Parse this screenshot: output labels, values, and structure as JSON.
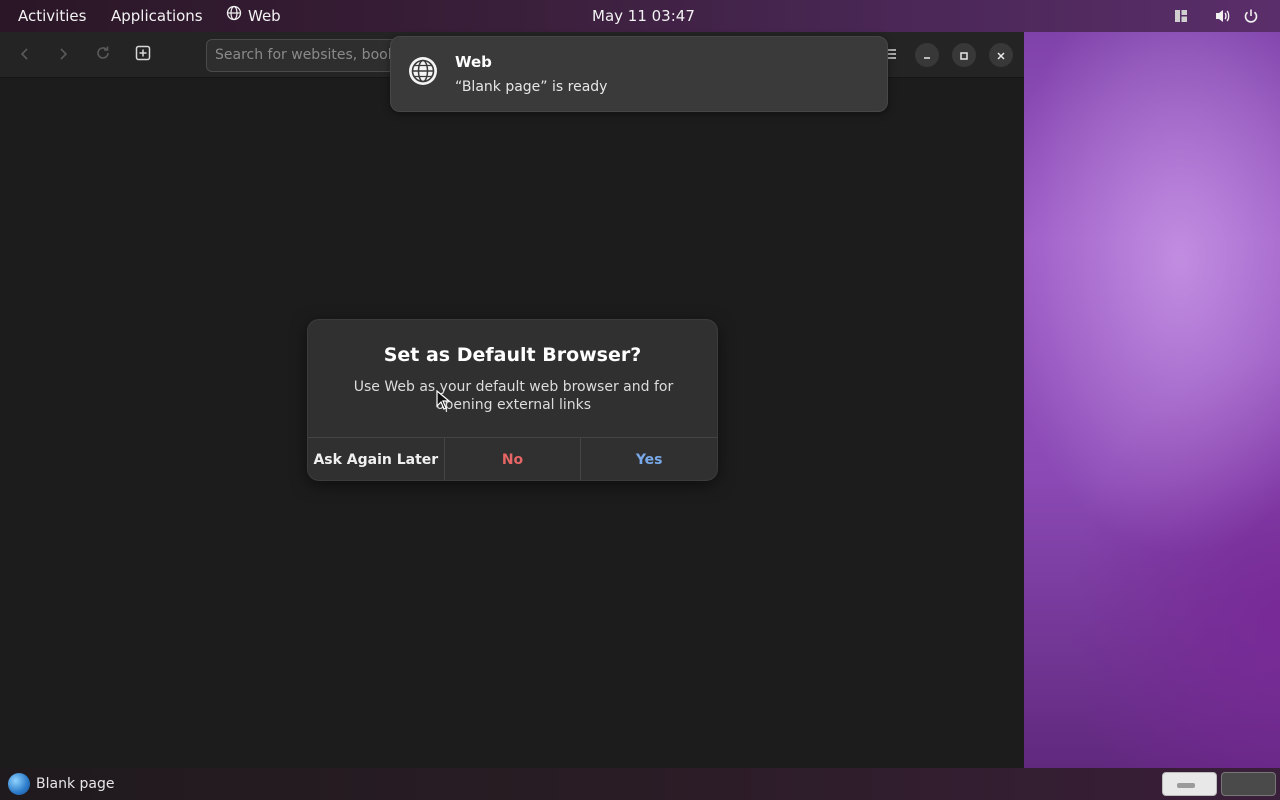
{
  "topbar": {
    "activities": "Activities",
    "applications": "Applications",
    "app_name": "Web",
    "clock": "May 11  03:47"
  },
  "browser": {
    "url_placeholder": "Search for websites, bookm"
  },
  "notification": {
    "title": "Web",
    "body": "“Blank page” is ready"
  },
  "dialog": {
    "title": "Set as Default Browser?",
    "body": "Use Web as your default web browser and for opening external links",
    "buttons": {
      "later": "Ask Again Later",
      "no": "No",
      "yes": "Yes"
    }
  },
  "taskbar": {
    "window_title": "Blank page"
  },
  "colors": {
    "no_button": "#e66565",
    "yes_button": "#78a9e8"
  }
}
